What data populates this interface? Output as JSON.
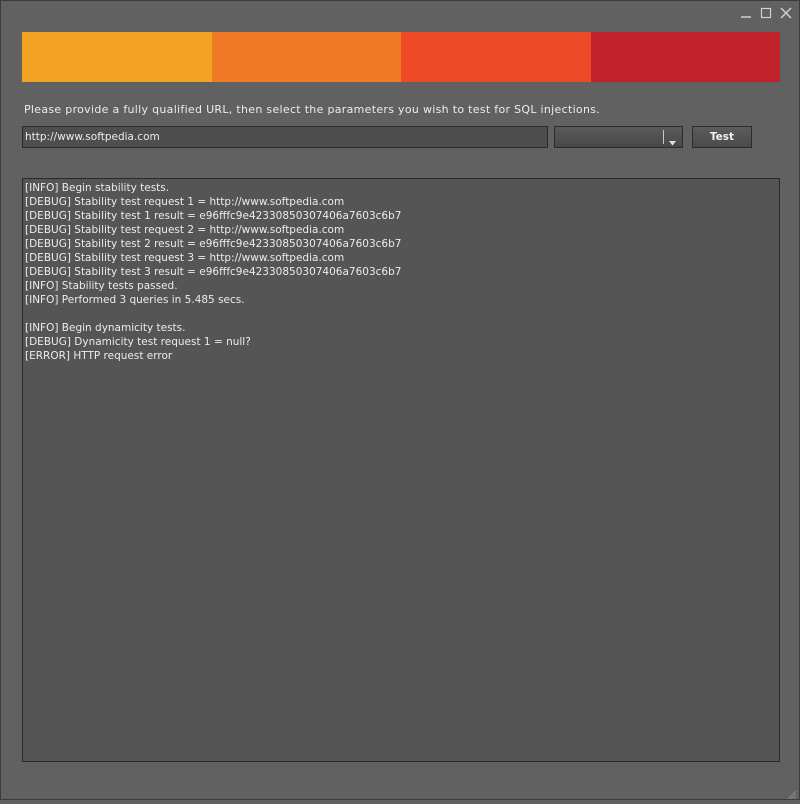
{
  "window": {
    "controls": [
      {
        "name": "minimize-icon"
      },
      {
        "name": "maximize-icon"
      },
      {
        "name": "close-icon"
      }
    ]
  },
  "banner": {
    "colors": [
      "#f2a323",
      "#f07a28",
      "#ee4a27",
      "#bf2229"
    ]
  },
  "instruction": "Please provide a fully qualified URL, then select the parameters you wish to test for SQL injections.",
  "url_input": {
    "value": "http://www.softpedia.com"
  },
  "param_select": {
    "selected": ""
  },
  "test_button": {
    "label": "Test"
  },
  "log": {
    "lines": [
      "[INFO] Begin stability tests.",
      "[DEBUG] Stability test request 1 = http://www.softpedia.com",
      "[DEBUG] Stability test 1 result = e96fffc9e42330850307406a7603c6b7",
      "[DEBUG] Stability test request 2 = http://www.softpedia.com",
      "[DEBUG] Stability test 2 result = e96fffc9e42330850307406a7603c6b7",
      "[DEBUG] Stability test request 3 = http://www.softpedia.com",
      "[DEBUG] Stability test 3 result = e96fffc9e42330850307406a7603c6b7",
      "[INFO] Stability tests passed.",
      "[INFO] Performed 3 queries in 5.485 secs.",
      "",
      "[INFO] Begin dynamicity tests.",
      "[DEBUG] Dynamicity test request 1 = null?",
      "[ERROR] HTTP request error"
    ]
  },
  "colors": {
    "background": "#616161",
    "log_background": "#555555",
    "text": "#ececec"
  }
}
